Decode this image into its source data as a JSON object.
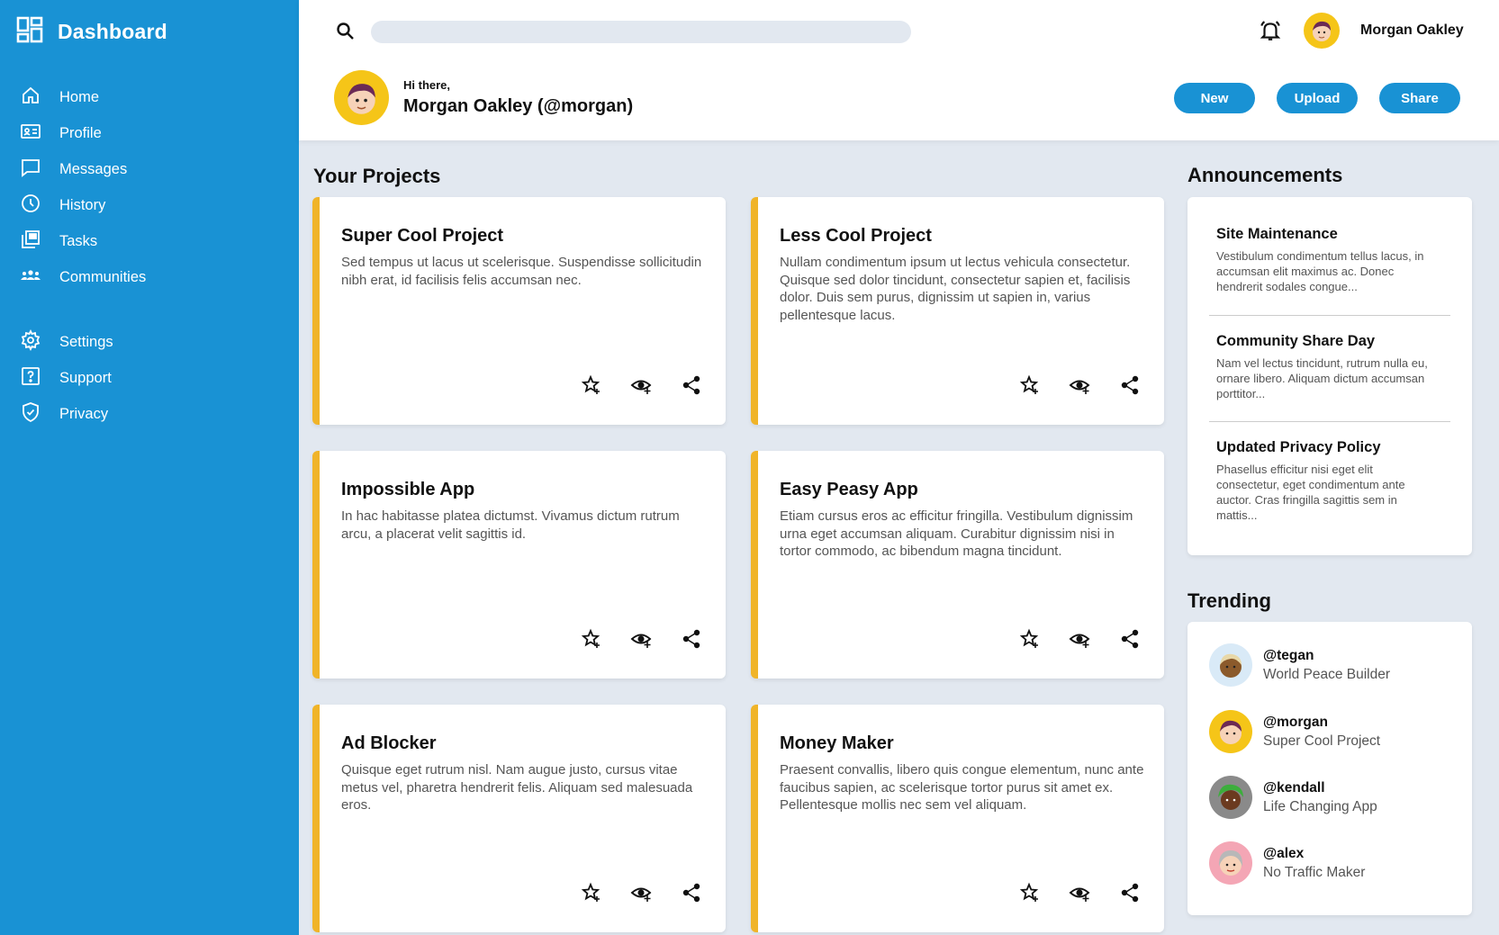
{
  "sidebar": {
    "title": "Dashboard",
    "items": [
      {
        "label": "Home",
        "icon": "home-icon"
      },
      {
        "label": "Profile",
        "icon": "id-card-icon"
      },
      {
        "label": "Messages",
        "icon": "message-icon"
      },
      {
        "label": "History",
        "icon": "clock-icon"
      },
      {
        "label": "Tasks",
        "icon": "tasks-icon"
      },
      {
        "label": "Communities",
        "icon": "people-icon"
      },
      {
        "label": "Settings",
        "icon": "gear-icon"
      },
      {
        "label": "Support",
        "icon": "help-icon"
      },
      {
        "label": "Privacy",
        "icon": "shield-icon"
      }
    ]
  },
  "header": {
    "search_placeholder": "",
    "username": "Morgan Oakley",
    "greeting": "Hi there,",
    "greeting_name": "Morgan Oakley (@morgan)",
    "buttons": {
      "new": "New",
      "upload": "Upload",
      "share": "Share"
    }
  },
  "projects": {
    "title": "Your Projects",
    "items": [
      {
        "title": "Super Cool Project",
        "desc": "Sed tempus ut lacus ut scelerisque. Suspendisse sollicitudin nibh erat, id facilisis felis accumsan nec."
      },
      {
        "title": "Less Cool Project",
        "desc": "Nullam condimentum ipsum ut lectus vehicula consectetur. Quisque sed dolor tincidunt, consectetur sapien et, facilisis dolor. Duis sem purus, dignissim ut sapien in, varius pellentesque lacus."
      },
      {
        "title": "Impossible App",
        "desc": "In hac habitasse platea dictumst. Vivamus dictum rutrum arcu, a placerat velit sagittis id."
      },
      {
        "title": "Easy Peasy App",
        "desc": "Etiam cursus eros ac efficitur fringilla. Vestibulum dignissim urna eget accumsan aliquam. Curabitur dignissim nisi in tortor commodo, ac bibendum magna tincidunt."
      },
      {
        "title": "Ad Blocker",
        "desc": "Quisque eget rutrum nisl. Nam augue justo, cursus vitae metus vel, pharetra hendrerit felis. Aliquam sed malesuada eros."
      },
      {
        "title": "Money Maker",
        "desc": "Praesent convallis, libero quis congue elementum, nunc ante faucibus sapien, ac scelerisque tortor purus sit amet ex. Pellentesque mollis nec sem vel aliquam."
      }
    ]
  },
  "announcements": {
    "title": "Announcements",
    "items": [
      {
        "title": "Site Maintenance",
        "body": "Vestibulum condimentum tellus lacus, in accumsan elit maximus ac. Donec hendrerit sodales congue..."
      },
      {
        "title": "Community Share Day",
        "body": "Nam vel lectus tincidunt, rutrum nulla eu, ornare libero. Aliquam dictum accumsan porttitor..."
      },
      {
        "title": "Updated Privacy Policy",
        "body": "Phasellus efficitur nisi eget elit consectetur, eget condimentum ante auctor. Cras fringilla sagittis sem in mattis..."
      }
    ]
  },
  "trending": {
    "title": "Trending",
    "items": [
      {
        "user": "@tegan",
        "project": "World Peace Builder",
        "avatar_bg": "#d9eaf7"
      },
      {
        "user": "@morgan",
        "project": "Super Cool Project",
        "avatar_bg": "#f5c518"
      },
      {
        "user": "@kendall",
        "project": "Life Changing App",
        "avatar_bg": "#8a8a8a"
      },
      {
        "user": "@alex",
        "project": "No Traffic Maker",
        "avatar_bg": "#f4a6b5"
      }
    ]
  },
  "colors": {
    "primary": "#1992d4",
    "accent": "#f0b429",
    "background": "#e2e8f0"
  }
}
